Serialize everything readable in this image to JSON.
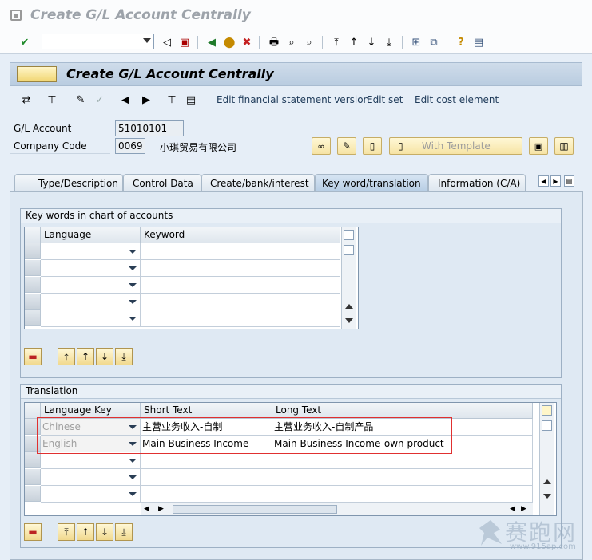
{
  "window": {
    "title": "Create G/L Account Centrally"
  },
  "screen": {
    "title": "Create G/L Account Centrally"
  },
  "app_toolbar": {
    "links": [
      "Edit financial statement version",
      "Edit set",
      "Edit cost element"
    ]
  },
  "header_fields": {
    "gl_account_label": "G/L Account",
    "gl_account_value": "51010101",
    "company_code_label": "Company Code",
    "company_code_value": "0069",
    "company_name": "小琪贸易有限公司",
    "with_template_label": "With Template"
  },
  "tabs": [
    {
      "label": "Type/Description"
    },
    {
      "label": "Control Data"
    },
    {
      "label": "Create/bank/interest"
    },
    {
      "label": "Key word/translation",
      "active": true
    },
    {
      "label": "Information (C/A)"
    }
  ],
  "keywords": {
    "group_title": "Key words in chart of accounts",
    "columns": [
      "Language",
      "Keyword"
    ],
    "rows": [
      {
        "language": "",
        "keyword": ""
      },
      {
        "language": "",
        "keyword": ""
      },
      {
        "language": "",
        "keyword": ""
      },
      {
        "language": "",
        "keyword": ""
      },
      {
        "language": "",
        "keyword": ""
      }
    ]
  },
  "translation": {
    "group_title": "Translation",
    "columns": [
      "Language Key",
      "Short Text",
      "Long Text"
    ],
    "rows": [
      {
        "language": "Chinese",
        "short": "主营业务收入-自制",
        "long": "主营业务收入-自制产品"
      },
      {
        "language": "English",
        "short": "Main Business Income",
        "long": "Main Business Income-own product"
      },
      {
        "language": "",
        "short": "",
        "long": ""
      },
      {
        "language": "",
        "short": "",
        "long": ""
      },
      {
        "language": "",
        "short": "",
        "long": ""
      }
    ]
  },
  "watermark": {
    "text": "赛跑网",
    "url": "www.915ap.com"
  },
  "colors": {
    "highlight": "#e03030",
    "header_bg": "#b9cce0"
  }
}
